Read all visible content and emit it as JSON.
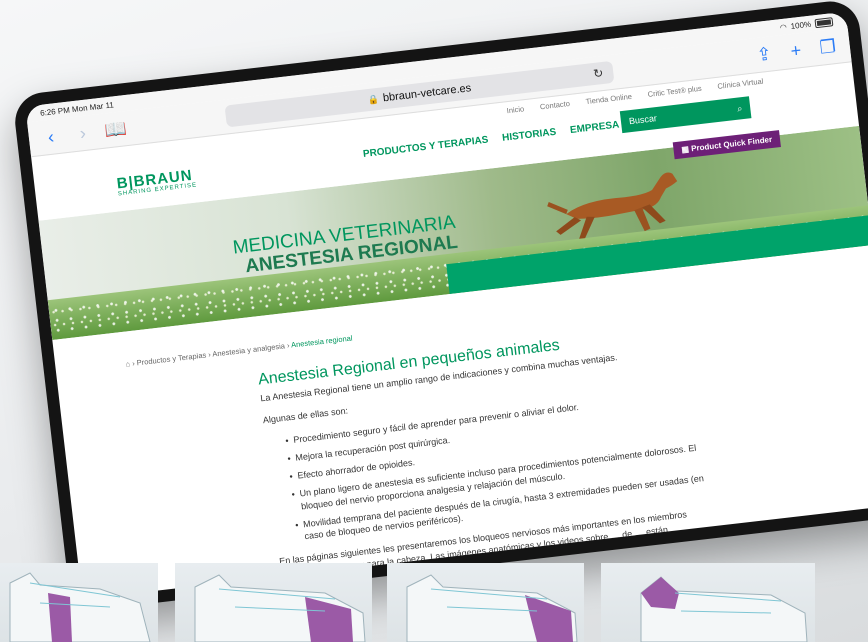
{
  "ios": {
    "time": "6:26 PM",
    "date": "Mon Mar 11",
    "battery": "100%"
  },
  "browser": {
    "url": "bbraun-vetcare.es"
  },
  "site": {
    "utility_links": [
      "Inicio",
      "Contacto",
      "Tienda Online",
      "Critic Test® plus",
      "Clínica Virtual"
    ],
    "logo": {
      "brand": "B|BRAUN",
      "tagline": "SHARING EXPERTISE"
    },
    "main_nav": [
      "PRODUCTOS Y TERAPIAS",
      "HISTORIAS",
      "EMPRESA"
    ],
    "search_placeholder": "Buscar",
    "hero": {
      "line1": "MEDICINA VETERINARIA",
      "line2": "ANESTESIA REGIONAL"
    },
    "product_finder": "Product Quick Finder",
    "breadcrumb": [
      "Productos y Terapias",
      "Anestesia y analgesia",
      "Anestesia regional"
    ],
    "heading": "Anestesia Regional en pequeños animales",
    "intro": "La Anestesia Regional tiene un amplio rango de indicaciones y combina muchas ventajas.",
    "list_intro": "Algunas de ellas son:",
    "benefits": [
      "Procedimiento seguro y fácil de aprender para prevenir o aliviar el dolor.",
      "Mejora la recuperación post quirúrgica.",
      "Efecto ahorrador de opioides.",
      "Un plano ligero de anestesia es suficiente incluso para procedimientos potencialmente dolorosos. El bloqueo del nervio proporciona analgesia y relajación del músculo.",
      "Movilidad temprana del paciente después de la cirugía, hasta 3 extremidades pueden ser usadas (en caso de bloqueo de nervios periféricos)."
    ],
    "closing": "En las páginas siguientes les presentaremos los bloqueos nerviosos más importantes en los miembros anterior y posterior, y para la cabeza. Las imágenes anatómicas y los videos sobre … de … están diseñadas para ayudarte en el manejo"
  },
  "colors": {
    "brand_green": "#00965e",
    "bar_green": "#00a36a",
    "purple": "#6d2077",
    "limb_purple": "#9b5aa6"
  },
  "thumbnails": [
    "dog-forelimb-block",
    "dog-hindlimb-block",
    "dog-hindlimb-block-2",
    "dog-head-block"
  ]
}
